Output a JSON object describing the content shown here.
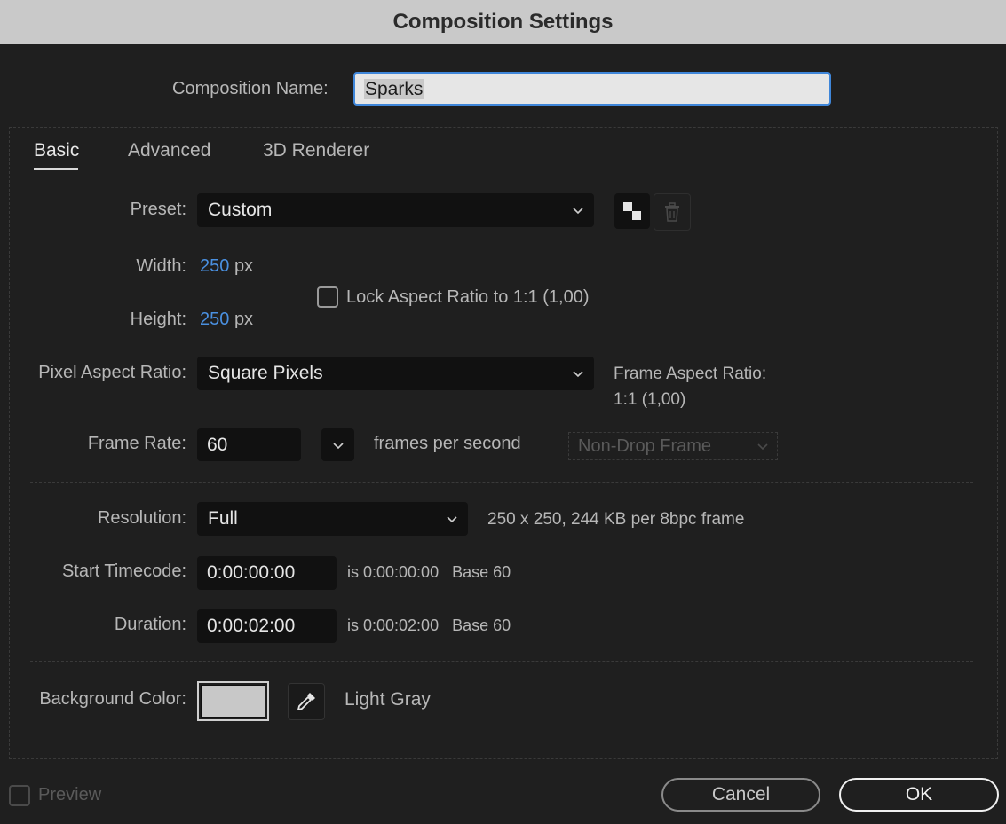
{
  "window": {
    "title": "Composition Settings"
  },
  "comp_name": {
    "label": "Composition Name:",
    "value": "Sparks"
  },
  "tabs": [
    {
      "label": "Basic",
      "active": true
    },
    {
      "label": "Advanced",
      "active": false
    },
    {
      "label": "3D Renderer",
      "active": false
    }
  ],
  "preset": {
    "label": "Preset:",
    "value": "Custom",
    "save_icon": "save-preset-icon",
    "delete_icon": "trash-icon"
  },
  "width": {
    "label": "Width:",
    "value": "250",
    "unit": "px"
  },
  "height": {
    "label": "Height:",
    "value": "250",
    "unit": "px"
  },
  "lock_aspect": {
    "label": "Lock Aspect Ratio to 1:1 (1,00)",
    "checked": false
  },
  "pixel_aspect": {
    "label": "Pixel Aspect Ratio:",
    "value": "Square Pixels"
  },
  "frame_aspect": {
    "label": "Frame Aspect Ratio:",
    "value": "1:1 (1,00)"
  },
  "frame_rate": {
    "label": "Frame Rate:",
    "value": "60",
    "unit": "frames per second",
    "drop_frame": "Non-Drop Frame"
  },
  "resolution": {
    "label": "Resolution:",
    "value": "Full",
    "info": "250 x 250, 244 KB per 8bpc frame"
  },
  "start_timecode": {
    "label": "Start Timecode:",
    "value": "0:00:00:00",
    "is_label": "is 0:00:00:00",
    "base": "Base 60"
  },
  "duration": {
    "label": "Duration:",
    "value": "0:00:02:00",
    "is_label": "is 0:00:02:00",
    "base": "Base 60"
  },
  "background": {
    "label": "Background Color:",
    "color": "#c8c8c8",
    "name": "Light Gray",
    "eyedropper_icon": "eyedropper-icon"
  },
  "footer": {
    "preview_label": "Preview",
    "cancel_label": "Cancel",
    "ok_label": "OK"
  },
  "colors": {
    "accent": "#4a90e0",
    "focus_border": "#3f86d9"
  }
}
